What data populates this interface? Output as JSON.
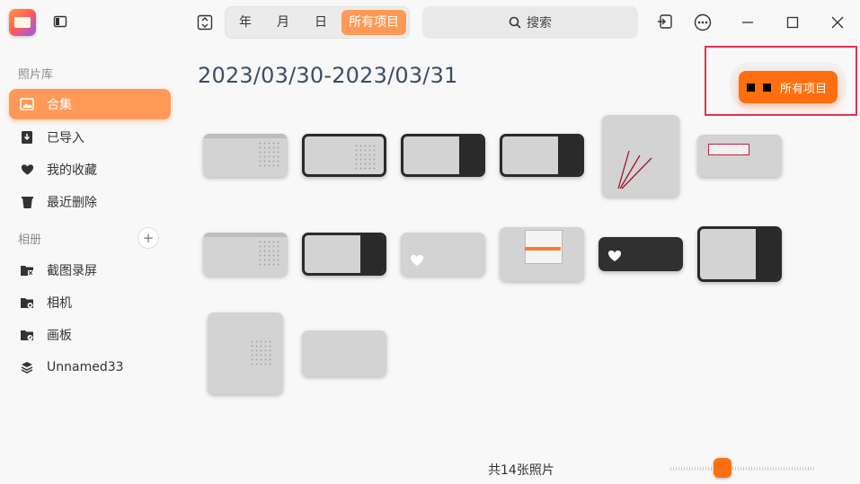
{
  "sidebar": {
    "section_library": "照片库",
    "items": [
      {
        "label": "合集",
        "icon": "image-icon",
        "active": true
      },
      {
        "label": "已导入",
        "icon": "import-icon"
      },
      {
        "label": "我的收藏",
        "icon": "heart-icon"
      },
      {
        "label": "最近删除",
        "icon": "trash-icon"
      }
    ],
    "section_albums": "相册",
    "add_label": "+",
    "albums": [
      {
        "label": "截图录屏",
        "icon": "folder-screenshot-icon"
      },
      {
        "label": "相机",
        "icon": "folder-camera-icon"
      },
      {
        "label": "画板",
        "icon": "folder-drawing-icon"
      },
      {
        "label": "Unnamed33",
        "icon": "layers-icon"
      }
    ]
  },
  "header": {
    "view_tabs": [
      "年",
      "月",
      "日",
      "所有项目"
    ],
    "selected_tab": "所有项目",
    "search_label": "搜索"
  },
  "main": {
    "title": "2023/03/30-2023/03/31",
    "floating_button_label": "所有项目",
    "photo_count": "共14张照片"
  },
  "colors": {
    "accent": "#ff9957",
    "accent_strong": "#ff6f10",
    "highlight": "#e83050",
    "title": "#3d4e63"
  }
}
